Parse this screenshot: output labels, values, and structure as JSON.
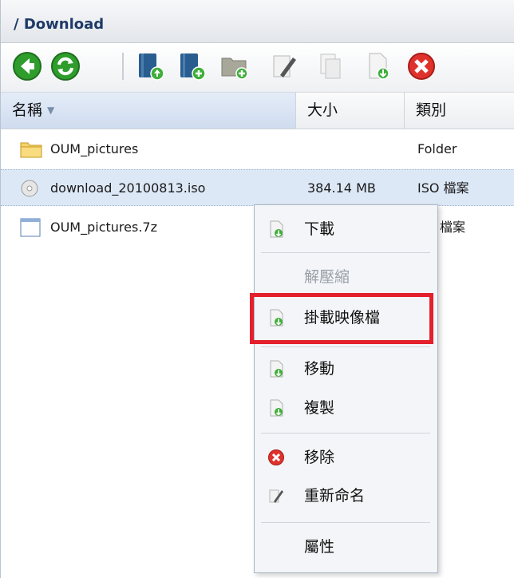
{
  "breadcrumb": {
    "path": "/ Download"
  },
  "toolbar": {
    "buttons": [
      {
        "icon": "back-arrow-icon"
      },
      {
        "icon": "refresh-icon"
      },
      {
        "icon": "upload-book-icon"
      },
      {
        "icon": "add-book-icon"
      },
      {
        "icon": "new-folder-icon"
      },
      {
        "icon": "rename-icon"
      },
      {
        "icon": "copy-icon"
      },
      {
        "icon": "download-file-icon"
      },
      {
        "icon": "delete-icon"
      }
    ]
  },
  "columns": {
    "name": "名稱",
    "size": "大小",
    "type": "類別"
  },
  "files": [
    {
      "name": "OUM_pictures",
      "size": "",
      "type": "Folder",
      "icon": "folder-icon"
    },
    {
      "name": "download_20100813.iso",
      "size": "384.14 MB",
      "type": "ISO 檔案",
      "icon": "disc-icon"
    },
    {
      "name": "OUM_pictures.7z",
      "size": "",
      "type": "檔案",
      "icon": "file-icon"
    }
  ],
  "context_menu": {
    "items": [
      {
        "label": "下載",
        "icon": "download-icon",
        "enabled": true
      },
      {
        "label": "解壓縮",
        "icon": "",
        "enabled": false
      },
      {
        "label": "掛載映像檔",
        "icon": "download-icon",
        "enabled": true,
        "highlighted": true
      },
      {
        "label": "移動",
        "icon": "download-icon",
        "enabled": true
      },
      {
        "label": "複製",
        "icon": "download-icon",
        "enabled": true
      },
      {
        "label": "移除",
        "icon": "delete-icon",
        "enabled": true
      },
      {
        "label": "重新命名",
        "icon": "rename-icon",
        "enabled": true
      },
      {
        "label": "屬性",
        "icon": "",
        "enabled": true
      }
    ]
  },
  "colors": {
    "highlight_border": "#e3202b",
    "selection": "#dde8f6",
    "path_text": "#1e3a66"
  }
}
